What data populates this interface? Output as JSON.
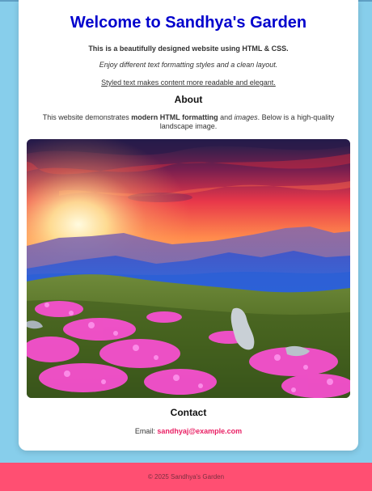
{
  "header": {
    "title": "Welcome to Sandhya's Garden"
  },
  "intro": {
    "bold_line": "This is a beautifully designed website using HTML & CSS.",
    "italic_line": "Enjoy different text formatting styles and a clean layout.",
    "underline_line": "Styled text makes content more readable and elegant."
  },
  "about": {
    "heading": "About",
    "text_before": "This website demonstrates ",
    "text_bold": "modern HTML formatting",
    "text_middle": " and ",
    "text_italic": "images",
    "text_after": ". Below is a high-quality landscape image."
  },
  "contact": {
    "heading": "Contact",
    "email_label": "Email: ",
    "email": "sandhyaj@example.com"
  },
  "footer": {
    "text": "© 2025 Sandhya's Garden"
  },
  "colors": {
    "page_background": "#87ceeb",
    "title": "#0000cd",
    "email_link": "#e91e63",
    "footer_background": "#ff4f72"
  }
}
